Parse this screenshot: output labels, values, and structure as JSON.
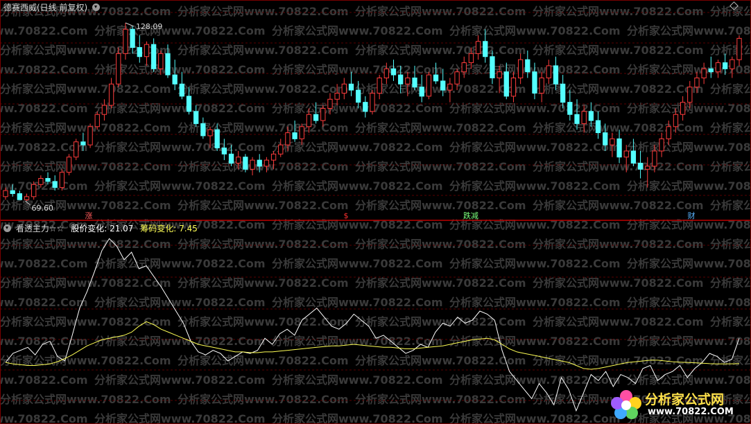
{
  "header": {
    "title": "德赛西威(日线 前复权)"
  },
  "watermark": {
    "text": "分析家公式网www.70822.Com"
  },
  "price_panel": {
    "high_label": "128.09",
    "low_label": "69.60",
    "signals": [
      {
        "label": "涨",
        "color": "#ff5a5a"
      },
      {
        "label": "$",
        "color": "#ff3030"
      },
      {
        "label": "跌减",
        "color": "#7cff7c"
      },
      {
        "label": "财",
        "color": "#5ab4ff"
      }
    ]
  },
  "indicator_panel": {
    "name": "看透主力☆☆",
    "label1": "股价变化:",
    "value1": "21.07",
    "label2": "筹码变化:",
    "value2": "7.45"
  },
  "logo": {
    "text": "分析家公式网",
    "url": "www.70822.COM"
  },
  "colors": {
    "up": "#ff3c3c",
    "down": "#54ffff",
    "divider": "#c00000",
    "white_line": "#ffffff",
    "yellow_line": "#ffff55"
  },
  "chart_data": {
    "type": "candlestick",
    "candles": [
      [
        71,
        74,
        70,
        73
      ],
      [
        73,
        75,
        71,
        72
      ],
      [
        72,
        73,
        70,
        70
      ],
      [
        70,
        72,
        69.6,
        71
      ],
      [
        71,
        76,
        70,
        75
      ],
      [
        75,
        78,
        74,
        77
      ],
      [
        77,
        79,
        75,
        76
      ],
      [
        76,
        78,
        73,
        74
      ],
      [
        74,
        80,
        73,
        79
      ],
      [
        79,
        85,
        78,
        84
      ],
      [
        84,
        90,
        83,
        89
      ],
      [
        89,
        92,
        86,
        88
      ],
      [
        88,
        95,
        87,
        94
      ],
      [
        94,
        99,
        93,
        98
      ],
      [
        98,
        103,
        96,
        101
      ],
      [
        101,
        110,
        100,
        108
      ],
      [
        108,
        120,
        107,
        118
      ],
      [
        118,
        128.09,
        116,
        126
      ],
      [
        126,
        127,
        118,
        120
      ],
      [
        120,
        124,
        115,
        117
      ],
      [
        117,
        122,
        114,
        121
      ],
      [
        121,
        123,
        112,
        113
      ],
      [
        113,
        119,
        111,
        118
      ],
      [
        118,
        121,
        110,
        111
      ],
      [
        111,
        116,
        106,
        108
      ],
      [
        108,
        112,
        103,
        104
      ],
      [
        104,
        107,
        98,
        99
      ],
      [
        99,
        101,
        94,
        95
      ],
      [
        95,
        97,
        90,
        91
      ],
      [
        91,
        94,
        87,
        93
      ],
      [
        93,
        95,
        86,
        87
      ],
      [
        87,
        90,
        83,
        85
      ],
      [
        85,
        88,
        81,
        82
      ],
      [
        82,
        86,
        80,
        84
      ],
      [
        84,
        85,
        79,
        80
      ],
      [
        80,
        84,
        78,
        83
      ],
      [
        83,
        85,
        79,
        81
      ],
      [
        81,
        84,
        79,
        83
      ],
      [
        83,
        86,
        80,
        85
      ],
      [
        85,
        90,
        84,
        88
      ],
      [
        88,
        94,
        86,
        92
      ],
      [
        92,
        96,
        89,
        90
      ],
      [
        90,
        95,
        88,
        94
      ],
      [
        94,
        100,
        92,
        98
      ],
      [
        98,
        102,
        95,
        96
      ],
      [
        96,
        101,
        94,
        100
      ],
      [
        100,
        105,
        98,
        103
      ],
      [
        103,
        108,
        101,
        105
      ],
      [
        105,
        110,
        103,
        108
      ],
      [
        108,
        112,
        104,
        106
      ],
      [
        106,
        109,
        100,
        102
      ],
      [
        102,
        104,
        97,
        99
      ],
      [
        99,
        106,
        98,
        105
      ],
      [
        105,
        111,
        103,
        110
      ],
      [
        110,
        115,
        108,
        113
      ],
      [
        113,
        116,
        109,
        111
      ],
      [
        111,
        114,
        105,
        108
      ],
      [
        108,
        112,
        104,
        110
      ],
      [
        110,
        114,
        106,
        107
      ],
      [
        107,
        111,
        102,
        104
      ],
      [
        104,
        112,
        103,
        111
      ],
      [
        111,
        115,
        108,
        109
      ],
      [
        109,
        113,
        104,
        106
      ],
      [
        106,
        110,
        102,
        108
      ],
      [
        108,
        113,
        106,
        112
      ],
      [
        112,
        117,
        110,
        115
      ],
      [
        115,
        120,
        113,
        118
      ],
      [
        118,
        124,
        116,
        122
      ],
      [
        122,
        126,
        115,
        117
      ],
      [
        117,
        119,
        108,
        110
      ],
      [
        110,
        114,
        105,
        112
      ],
      [
        112,
        115,
        103,
        104
      ],
      [
        104,
        112,
        102,
        110
      ],
      [
        110,
        118,
        108,
        116
      ],
      [
        116,
        119,
        110,
        112
      ],
      [
        112,
        115,
        103,
        105
      ],
      [
        105,
        112,
        102,
        110
      ],
      [
        110,
        116,
        108,
        114
      ],
      [
        114,
        117,
        106,
        108
      ],
      [
        108,
        111,
        100,
        102
      ],
      [
        102,
        106,
        96,
        98
      ],
      [
        98,
        103,
        93,
        95
      ],
      [
        95,
        101,
        92,
        99
      ],
      [
        99,
        102,
        94,
        96
      ],
      [
        96,
        99,
        90,
        92
      ],
      [
        92,
        95,
        86,
        88
      ],
      [
        88,
        92,
        84,
        90
      ],
      [
        90,
        93,
        82,
        84
      ],
      [
        84,
        88,
        79,
        86
      ],
      [
        86,
        90,
        81,
        82
      ],
      [
        82,
        86,
        77,
        80
      ],
      [
        80,
        84,
        74,
        81
      ],
      [
        81,
        88,
        79,
        86
      ],
      [
        86,
        92,
        84,
        90
      ],
      [
        90,
        96,
        88,
        94
      ],
      [
        94,
        100,
        92,
        98
      ],
      [
        98,
        104,
        96,
        102
      ],
      [
        102,
        109,
        100,
        107
      ],
      [
        107,
        112,
        105,
        110
      ],
      [
        110,
        115,
        108,
        113
      ],
      [
        113,
        117,
        110,
        112
      ],
      [
        112,
        116,
        110,
        115
      ],
      [
        115,
        118,
        111,
        113
      ],
      [
        113,
        117,
        110,
        116
      ],
      [
        116,
        124,
        114,
        123
      ]
    ],
    "indicator": {
      "white": [
        -2,
        4,
        6,
        8,
        3,
        10,
        12,
        2,
        -1,
        16,
        34,
        45,
        58,
        72,
        80,
        75,
        66,
        71,
        60,
        62,
        55,
        48,
        40,
        32,
        24,
        12,
        5,
        3,
        6,
        4,
        -1,
        2,
        5,
        4,
        6,
        14,
        10,
        17,
        20,
        16,
        26,
        30,
        34,
        28,
        22,
        20,
        24,
        30,
        26,
        22,
        14,
        16,
        12,
        8,
        4,
        6,
        10,
        8,
        18,
        24,
        22,
        28,
        24,
        26,
        32,
        30,
        26,
        6,
        -8,
        -14,
        -20,
        -26,
        -16,
        -22,
        -30,
        -12,
        -20,
        -34,
        -22,
        -10,
        -14,
        -8,
        -18,
        -10,
        -12,
        -16,
        -6,
        -4,
        -14,
        -10,
        -8,
        -4,
        -12,
        -6,
        -2,
        4,
        2,
        -2,
        0,
        14
      ],
      "yellow": [
        -2,
        -3,
        -3.5,
        -4,
        -4,
        -3.5,
        -3,
        -1.5,
        0.5,
        3,
        6,
        9,
        11,
        13,
        14,
        15,
        16,
        18,
        22,
        25,
        23,
        20,
        18,
        16,
        14,
        12,
        10,
        9,
        8,
        7,
        6,
        5,
        5,
        4.5,
        4.5,
        5,
        5,
        5.5,
        6,
        6.5,
        7,
        7.5,
        8,
        8.5,
        9,
        9,
        9.5,
        10,
        9.5,
        9,
        8.5,
        8,
        8,
        7.5,
        7,
        7,
        7.5,
        8,
        8.5,
        9,
        10,
        11,
        12,
        13,
        13.5,
        14,
        13,
        10,
        7,
        5,
        4,
        3,
        2,
        1,
        0,
        -1,
        -2,
        -4,
        -6,
        -6.5,
        -6,
        -5,
        -4,
        -3,
        -2,
        -1.5,
        -1,
        -0.5,
        -0.5,
        -1,
        -1.5,
        -1.8,
        -2,
        -2.2,
        -2.5,
        -2.8,
        -3,
        -3,
        -2.9,
        -2.8
      ]
    }
  }
}
